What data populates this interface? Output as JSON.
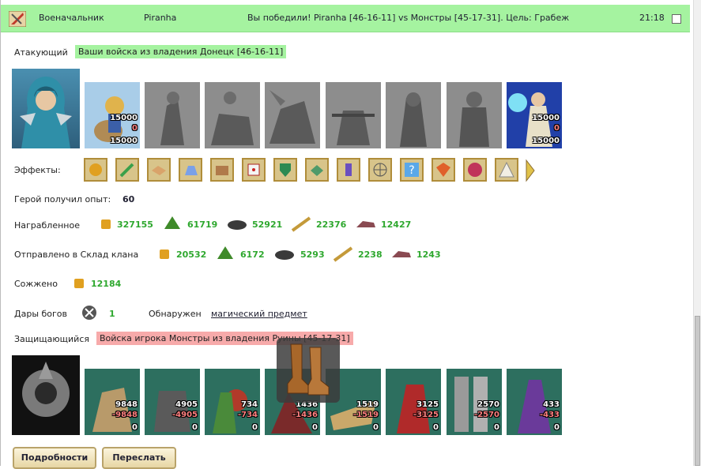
{
  "header": {
    "role": "Военачальник",
    "player": "Piranha",
    "result": "Вы победили! Piranha [46-16-11] vs Монстры [45-17-31]. Цель: Грабеж",
    "time": "21:18"
  },
  "attacker": {
    "label": "Атакующий",
    "tag": "Ваши войска из владения Донецк [46-16-11]",
    "units": [
      {
        "name": "knight-riders",
        "count": "15000",
        "loss": "0",
        "left": "15000",
        "active": true
      },
      {
        "name": "gray-1",
        "active": false
      },
      {
        "name": "gray-2",
        "active": false
      },
      {
        "name": "gray-3",
        "active": false
      },
      {
        "name": "gray-4",
        "active": false
      },
      {
        "name": "gray-5",
        "active": false
      },
      {
        "name": "gray-6",
        "active": false
      },
      {
        "name": "gray-7",
        "active": false
      },
      {
        "name": "mage",
        "count": "15000",
        "loss": "0",
        "left": "15000",
        "active": true
      }
    ]
  },
  "effects": {
    "label": "Эффекты:"
  },
  "experience": {
    "label": "Герой получил опыт:",
    "value": "60"
  },
  "loot": {
    "label": "Награбленное",
    "items": [
      {
        "icon": "gold-icon",
        "value": "327155"
      },
      {
        "icon": "wood-icon",
        "value": "61719"
      },
      {
        "icon": "ore-icon",
        "value": "52921"
      },
      {
        "icon": "grain-icon",
        "value": "22376"
      },
      {
        "icon": "stone-icon",
        "value": "12427"
      }
    ]
  },
  "clan_storage": {
    "label": "Отправлено в Склад клана",
    "items": [
      {
        "icon": "gold-icon",
        "value": "20532"
      },
      {
        "icon": "wood-icon",
        "value": "6172"
      },
      {
        "icon": "ore-icon",
        "value": "5293"
      },
      {
        "icon": "grain-icon",
        "value": "2238"
      },
      {
        "icon": "stone-icon",
        "value": "1243"
      }
    ]
  },
  "burned": {
    "label": "Сожжено",
    "value": "12184"
  },
  "gods": {
    "label": "Дары богов",
    "value": "1",
    "found_label": "Обнаружен",
    "found_link": "магический предмет"
  },
  "defender": {
    "label": "Защищающийся",
    "tag": "Войска игрока Монстры из владения Руины [45-17-31]",
    "units": [
      {
        "count": "9848",
        "loss": "-9848",
        "left": "0"
      },
      {
        "count": "4905",
        "loss": "-4905",
        "left": "0"
      },
      {
        "count": "734",
        "loss": "-734",
        "left": "0"
      },
      {
        "count": "1436",
        "loss": "-1436",
        "left": "0"
      },
      {
        "count": "1519",
        "loss": "-1519",
        "left": "0"
      },
      {
        "count": "3125",
        "loss": "-3125",
        "left": "0"
      },
      {
        "count": "2570",
        "loss": "-2570",
        "left": "0"
      },
      {
        "count": "433",
        "loss": "-433",
        "left": "0"
      }
    ]
  },
  "buttons": {
    "details": "Подробности",
    "forward": "Переслать"
  },
  "colors": {
    "header_bg": "#a5f3a0",
    "value_green": "#2fa82f",
    "defender_tag": "#f7aaaa"
  }
}
